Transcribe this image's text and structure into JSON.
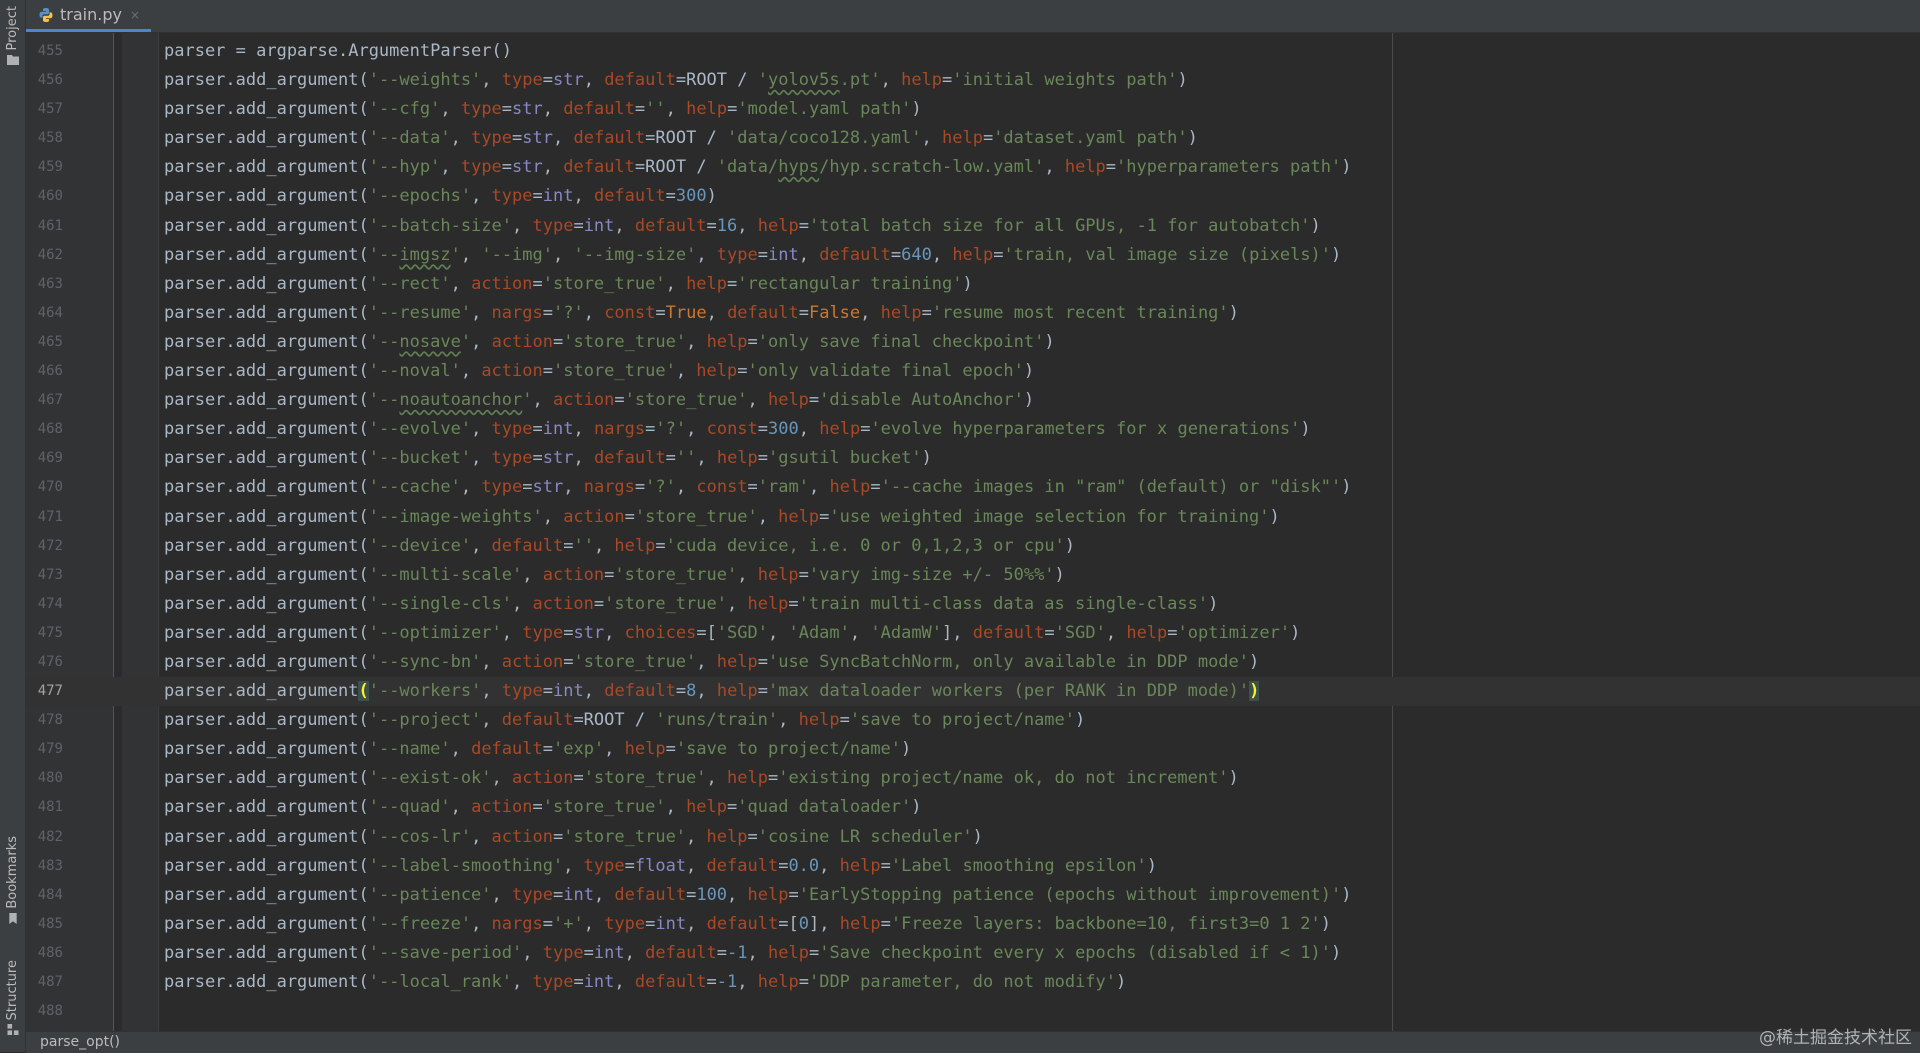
{
  "tool_windows": {
    "project": "Project",
    "bookmarks": "Bookmarks",
    "structure": "Structure"
  },
  "tab": {
    "filename": "train.py",
    "close": "×",
    "icon": "python-file-icon"
  },
  "editor": {
    "current_line": 477,
    "lines": [
      {
        "n": "455",
        "code": "parser = argparse.ArgumentParser()"
      },
      {
        "n": "456",
        "code": "parser.add_argument('--weights', type=str, default=ROOT / 'yolov5s.pt', help='initial weights path')"
      },
      {
        "n": "457",
        "code": "parser.add_argument('--cfg', type=str, default='', help='model.yaml path')"
      },
      {
        "n": "458",
        "code": "parser.add_argument('--data', type=str, default=ROOT / 'data/coco128.yaml', help='dataset.yaml path')"
      },
      {
        "n": "459",
        "code": "parser.add_argument('--hyp', type=str, default=ROOT / 'data/hyps/hyp.scratch-low.yaml', help='hyperparameters path')"
      },
      {
        "n": "460",
        "code": "parser.add_argument('--epochs', type=int, default=300)"
      },
      {
        "n": "461",
        "code": "parser.add_argument('--batch-size', type=int, default=16, help='total batch size for all GPUs, -1 for autobatch')"
      },
      {
        "n": "462",
        "code": "parser.add_argument('--imgsz', '--img', '--img-size', type=int, default=640, help='train, val image size (pixels)')"
      },
      {
        "n": "463",
        "code": "parser.add_argument('--rect', action='store_true', help='rectangular training')"
      },
      {
        "n": "464",
        "code": "parser.add_argument('--resume', nargs='?', const=True, default=False, help='resume most recent training')"
      },
      {
        "n": "465",
        "code": "parser.add_argument('--nosave', action='store_true', help='only save final checkpoint')"
      },
      {
        "n": "466",
        "code": "parser.add_argument('--noval', action='store_true', help='only validate final epoch')"
      },
      {
        "n": "467",
        "code": "parser.add_argument('--noautoanchor', action='store_true', help='disable AutoAnchor')"
      },
      {
        "n": "468",
        "code": "parser.add_argument('--evolve', type=int, nargs='?', const=300, help='evolve hyperparameters for x generations')"
      },
      {
        "n": "469",
        "code": "parser.add_argument('--bucket', type=str, default='', help='gsutil bucket')"
      },
      {
        "n": "470",
        "code": "parser.add_argument('--cache', type=str, nargs='?', const='ram', help='--cache images in \"ram\" (default) or \"disk\"')"
      },
      {
        "n": "471",
        "code": "parser.add_argument('--image-weights', action='store_true', help='use weighted image selection for training')"
      },
      {
        "n": "472",
        "code": "parser.add_argument('--device', default='', help='cuda device, i.e. 0 or 0,1,2,3 or cpu')"
      },
      {
        "n": "473",
        "code": "parser.add_argument('--multi-scale', action='store_true', help='vary img-size +/- 50%%')"
      },
      {
        "n": "474",
        "code": "parser.add_argument('--single-cls', action='store_true', help='train multi-class data as single-class')"
      },
      {
        "n": "475",
        "code": "parser.add_argument('--optimizer', type=str, choices=['SGD', 'Adam', 'AdamW'], default='SGD', help='optimizer')"
      },
      {
        "n": "476",
        "code": "parser.add_argument('--sync-bn', action='store_true', help='use SyncBatchNorm, only available in DDP mode')"
      },
      {
        "n": "477",
        "code": "parser.add_argument('--workers', type=int, default=8, help='max dataloader workers (per RANK in DDP mode)')"
      },
      {
        "n": "478",
        "code": "parser.add_argument('--project', default=ROOT / 'runs/train', help='save to project/name')"
      },
      {
        "n": "479",
        "code": "parser.add_argument('--name', default='exp', help='save to project/name')"
      },
      {
        "n": "480",
        "code": "parser.add_argument('--exist-ok', action='store_true', help='existing project/name ok, do not increment')"
      },
      {
        "n": "481",
        "code": "parser.add_argument('--quad', action='store_true', help='quad dataloader')"
      },
      {
        "n": "482",
        "code": "parser.add_argument('--cos-lr', action='store_true', help='cosine LR scheduler')"
      },
      {
        "n": "483",
        "code": "parser.add_argument('--label-smoothing', type=float, default=0.0, help='Label smoothing epsilon')"
      },
      {
        "n": "484",
        "code": "parser.add_argument('--patience', type=int, default=100, help='EarlyStopping patience (epochs without improvement)')"
      },
      {
        "n": "485",
        "code": "parser.add_argument('--freeze', nargs='+', type=int, default=[0], help='Freeze layers: backbone=10, first3=0 1 2')"
      },
      {
        "n": "486",
        "code": "parser.add_argument('--save-period', type=int, default=-1, help='Save checkpoint every x epochs (disabled if < 1)')"
      },
      {
        "n": "487",
        "code": "parser.add_argument('--local_rank', type=int, default=-1, help='DDP parameter, do not modify')"
      },
      {
        "n": "488",
        "code": ""
      }
    ]
  },
  "breadcrumb": {
    "function": "parse_opt()"
  },
  "watermark": "@稀土掘金技术社区",
  "colors": {
    "background": "#2b2b2b",
    "string": "#6a8759",
    "keyword_arg": "#aa4926",
    "builtin": "#8888c6",
    "number": "#6897bb",
    "constant": "#cc7832",
    "default_text": "#a9b7c6"
  }
}
